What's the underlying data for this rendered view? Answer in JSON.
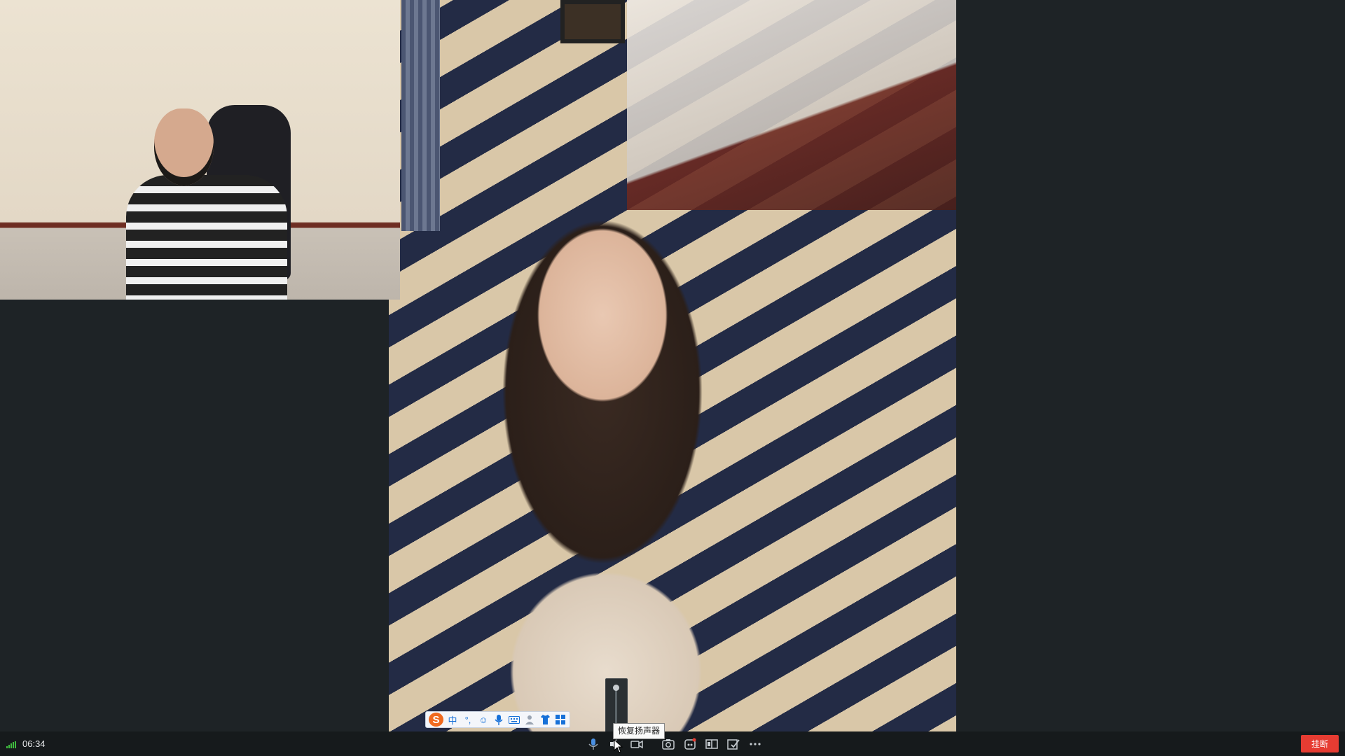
{
  "app": {
    "window_size": "1920x1080"
  },
  "ime_toolbar": {
    "logo": "S",
    "buttons": [
      {
        "icon": "chinese-mode-icon",
        "label": "中"
      },
      {
        "icon": "punctuation-icon",
        "label": "°,"
      },
      {
        "icon": "emoji-icon",
        "label": "☺"
      },
      {
        "icon": "voice-input-icon",
        "label": ""
      },
      {
        "icon": "keyboard-icon",
        "label": ""
      },
      {
        "icon": "user-icon",
        "label": ""
      },
      {
        "icon": "skin-icon",
        "label": ""
      },
      {
        "icon": "toolbox-icon",
        "label": ""
      }
    ]
  },
  "volume_slider": {
    "level": 0.95
  },
  "tooltip": {
    "text": "恢复扬声器"
  },
  "status_bar": {
    "signal": "strong",
    "call_time": "06:34",
    "hangup_label": "挂断",
    "hangup_color": "#e63c32",
    "controls": [
      "microphone-icon",
      "speaker-muted-icon",
      "camera-toggle-icon",
      "screenshot-icon",
      "record-icon",
      "split-view-icon",
      "whiteboard-icon",
      "more-icon"
    ]
  }
}
